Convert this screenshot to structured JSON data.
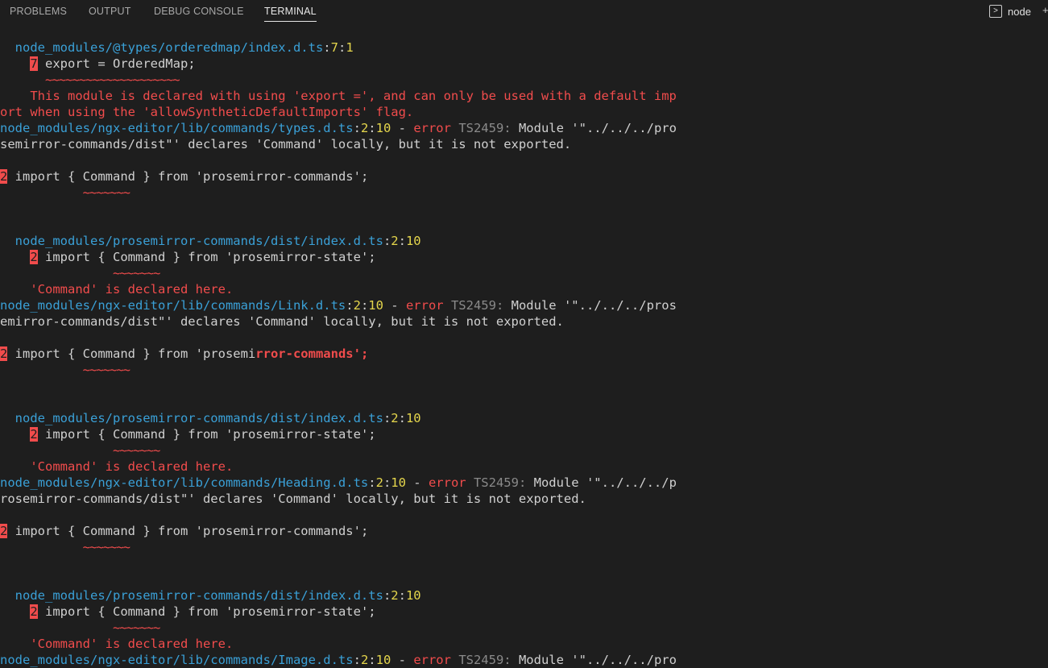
{
  "panel": {
    "tabs": [
      {
        "label": "PROBLEMS"
      },
      {
        "label": "OUTPUT"
      },
      {
        "label": "DEBUG CONSOLE"
      },
      {
        "label": "TERMINAL"
      }
    ],
    "terminal_name": "node",
    "terminal_icon": "terminal-icon",
    "add_icon": "plus-icon"
  },
  "terminal": {
    "lines": [
      [
        {
          "t": "  "
        },
        {
          "t": "node_modules/@types/orderedmap/index.d.ts",
          "c": "c-path"
        },
        {
          "t": ":",
          "c": "c-txt"
        },
        {
          "t": "7",
          "c": "c-num"
        },
        {
          "t": ":",
          "c": "c-txt"
        },
        {
          "t": "1",
          "c": "c-num"
        }
      ],
      [
        {
          "t": "    "
        },
        {
          "t": "7",
          "c": "lineno"
        },
        {
          "t": " export = OrderedMap;",
          "c": "c-txt"
        }
      ],
      [
        {
          "t": "      "
        },
        {
          "t": "~~~~~~~~~~~~~~~~~~~~",
          "c": "squig"
        }
      ],
      [
        {
          "t": "    This module is declared with using 'export =', and can only be used with a default imp",
          "c": "c-err"
        }
      ],
      [
        {
          "t": "ort when using the 'allowSyntheticDefaultImports' flag.",
          "c": "c-err"
        }
      ],
      [
        {
          "t": "node_modules/ngx-editor/lib/commands/types.d.ts",
          "c": "c-path"
        },
        {
          "t": ":",
          "c": "c-txt"
        },
        {
          "t": "2",
          "c": "c-num"
        },
        {
          "t": ":",
          "c": "c-txt"
        },
        {
          "t": "10",
          "c": "c-num"
        },
        {
          "t": " - ",
          "c": "c-txt"
        },
        {
          "t": "error",
          "c": "c-err"
        },
        {
          "t": " TS2459:",
          "c": "c-code"
        },
        {
          "t": " Module '\"../../../pro",
          "c": "c-txt"
        }
      ],
      [
        {
          "t": "semirror-commands/dist\"' declares 'Command' locally, but it is not exported.",
          "c": "c-txt"
        }
      ],
      [
        {
          "t": ""
        }
      ],
      [
        {
          "t": "2",
          "c": "lineno"
        },
        {
          "t": " import { Command } from 'prosemirror-commands';",
          "c": "c-txt"
        }
      ],
      [
        {
          "t": "           "
        },
        {
          "t": "~~~~~~~",
          "c": "squig"
        }
      ],
      [
        {
          "t": ""
        }
      ],
      [
        {
          "t": ""
        }
      ],
      [
        {
          "t": "  "
        },
        {
          "t": "node_modules/prosemirror-commands/dist/index.d.ts",
          "c": "c-path"
        },
        {
          "t": ":",
          "c": "c-txt"
        },
        {
          "t": "2",
          "c": "c-num"
        },
        {
          "t": ":",
          "c": "c-txt"
        },
        {
          "t": "10",
          "c": "c-num"
        }
      ],
      [
        {
          "t": "    "
        },
        {
          "t": "2",
          "c": "lineno"
        },
        {
          "t": " import { Command } from 'prosemirror-state';",
          "c": "c-txt"
        }
      ],
      [
        {
          "t": "               "
        },
        {
          "t": "~~~~~~~",
          "c": "squig"
        }
      ],
      [
        {
          "t": "    'Command' is declared here.",
          "c": "c-err"
        }
      ],
      [
        {
          "t": "node_modules/ngx-editor/lib/commands/Link.d.ts",
          "c": "c-path"
        },
        {
          "t": ":",
          "c": "c-txt"
        },
        {
          "t": "2",
          "c": "c-num"
        },
        {
          "t": ":",
          "c": "c-txt"
        },
        {
          "t": "10",
          "c": "c-num"
        },
        {
          "t": " - ",
          "c": "c-txt"
        },
        {
          "t": "error",
          "c": "c-err"
        },
        {
          "t": " TS2459:",
          "c": "c-code"
        },
        {
          "t": " Module '\"../../../pros",
          "c": "c-txt"
        }
      ],
      [
        {
          "t": "emirror-commands/dist\"' declares 'Command' locally, but it is not exported.",
          "c": "c-txt"
        }
      ],
      [
        {
          "t": ""
        }
      ],
      [
        {
          "t": "2",
          "c": "lineno"
        },
        {
          "t": " import { Command } from 'prosemi",
          "c": "c-txt"
        },
        {
          "t": "rror-commands';",
          "c": "c-err c-bold"
        }
      ],
      [
        {
          "t": "           "
        },
        {
          "t": "~~~~~~~",
          "c": "squig"
        }
      ],
      [
        {
          "t": ""
        }
      ],
      [
        {
          "t": ""
        }
      ],
      [
        {
          "t": "  "
        },
        {
          "t": "node_modules/prosemirror-commands/dist/index.d.ts",
          "c": "c-path"
        },
        {
          "t": ":",
          "c": "c-txt"
        },
        {
          "t": "2",
          "c": "c-num"
        },
        {
          "t": ":",
          "c": "c-txt"
        },
        {
          "t": "10",
          "c": "c-num"
        }
      ],
      [
        {
          "t": "    "
        },
        {
          "t": "2",
          "c": "lineno"
        },
        {
          "t": " import { Command } from 'prosemirror-state';",
          "c": "c-txt"
        }
      ],
      [
        {
          "t": "               "
        },
        {
          "t": "~~~~~~~",
          "c": "squig"
        }
      ],
      [
        {
          "t": "    'Command' is declared here.",
          "c": "c-err"
        }
      ],
      [
        {
          "t": "node_modules/ngx-editor/lib/commands/Heading.d.ts",
          "c": "c-path"
        },
        {
          "t": ":",
          "c": "c-txt"
        },
        {
          "t": "2",
          "c": "c-num"
        },
        {
          "t": ":",
          "c": "c-txt"
        },
        {
          "t": "10",
          "c": "c-num"
        },
        {
          "t": " - ",
          "c": "c-txt"
        },
        {
          "t": "error",
          "c": "c-err"
        },
        {
          "t": " TS2459:",
          "c": "c-code"
        },
        {
          "t": " Module '\"../../../p",
          "c": "c-txt"
        }
      ],
      [
        {
          "t": "rosemirror-commands/dist\"' declares 'Command' locally, but it is not exported.",
          "c": "c-txt"
        }
      ],
      [
        {
          "t": ""
        }
      ],
      [
        {
          "t": "2",
          "c": "lineno"
        },
        {
          "t": " import { Command } from 'prosemirror-commands';",
          "c": "c-txt"
        }
      ],
      [
        {
          "t": "           "
        },
        {
          "t": "~~~~~~~",
          "c": "squig"
        }
      ],
      [
        {
          "t": ""
        }
      ],
      [
        {
          "t": ""
        }
      ],
      [
        {
          "t": "  "
        },
        {
          "t": "node_modules/prosemirror-commands/dist/index.d.ts",
          "c": "c-path"
        },
        {
          "t": ":",
          "c": "c-txt"
        },
        {
          "t": "2",
          "c": "c-num"
        },
        {
          "t": ":",
          "c": "c-txt"
        },
        {
          "t": "10",
          "c": "c-num"
        }
      ],
      [
        {
          "t": "    "
        },
        {
          "t": "2",
          "c": "lineno"
        },
        {
          "t": " import { Command } from 'prosemirror-state';",
          "c": "c-txt"
        }
      ],
      [
        {
          "t": "               "
        },
        {
          "t": "~~~~~~~",
          "c": "squig"
        }
      ],
      [
        {
          "t": "    'Command' is declared here.",
          "c": "c-err"
        }
      ],
      [
        {
          "t": "node_modules/ngx-editor/lib/commands/Image.d.ts",
          "c": "c-path"
        },
        {
          "t": ":",
          "c": "c-txt"
        },
        {
          "t": "2",
          "c": "c-num"
        },
        {
          "t": ":",
          "c": "c-txt"
        },
        {
          "t": "10",
          "c": "c-num"
        },
        {
          "t": " - ",
          "c": "c-txt"
        },
        {
          "t": "error",
          "c": "c-err"
        },
        {
          "t": " TS2459:",
          "c": "c-code"
        },
        {
          "t": " Module '\"../../../pro",
          "c": "c-txt"
        }
      ]
    ]
  }
}
